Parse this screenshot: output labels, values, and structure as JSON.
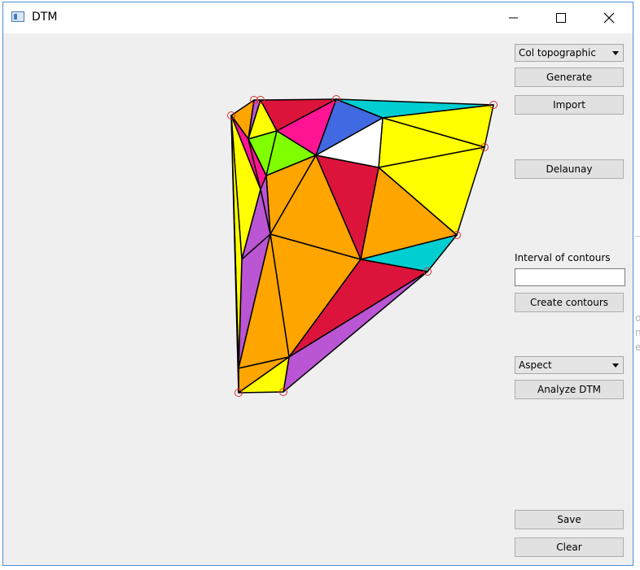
{
  "window": {
    "title": "DTM"
  },
  "controls": {
    "method_combo": {
      "selected": "Col topographic"
    },
    "generate_label": "Generate",
    "import_label": "Import",
    "delaunay_label": "Delaunay",
    "interval_label": "Interval of contours",
    "interval_value": "",
    "create_contours_label": "Create contours",
    "analysis_combo": {
      "selected": "Aspect"
    },
    "analyze_label": "Analyze DTM",
    "save_label": "Save",
    "clear_label": "Clear"
  },
  "colors": {
    "orange": "#ffa500",
    "yellow": "#ffff00",
    "red": "#dc143c",
    "cyan": "#00ced1",
    "blue": "#4169e1",
    "purple": "#ba55d3",
    "pink": "#ff1493",
    "green": "#7fff00",
    "white": "#ffffff",
    "point_marker": "#d83030"
  },
  "background_window_fragments": [
    "or",
    "n",
    "e"
  ]
}
